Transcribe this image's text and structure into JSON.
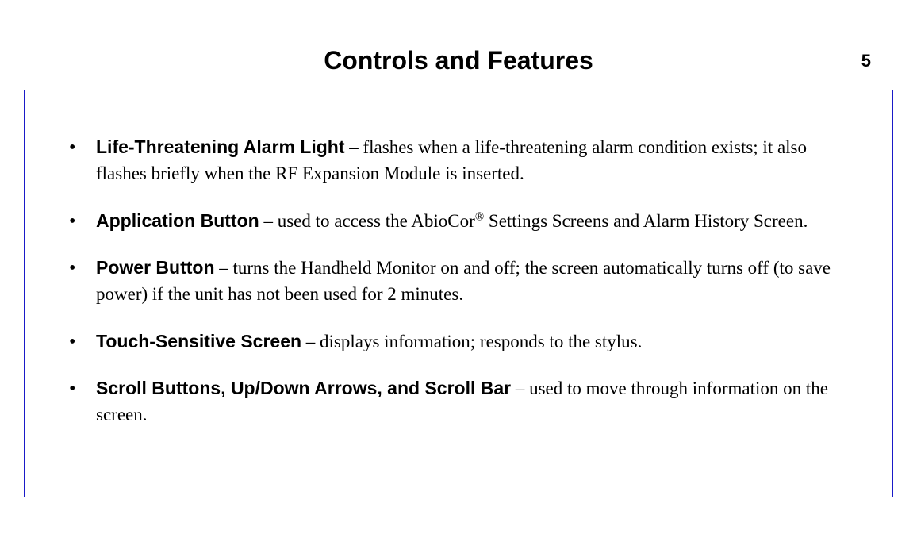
{
  "page_number": "5",
  "title": "Controls and Features",
  "items": [
    {
      "term": "Life-Threatening Alarm Light",
      "desc_before": " – flashes when a life-threatening alarm condition exists; it also flashes briefly when the RF Expansion Module is inserted.",
      "has_sup": false
    },
    {
      "term": "Application Button",
      "desc_before": " – used to access the AbioCor",
      "sup": "®",
      "desc_after": " Settings Screens and Alarm History Screen.",
      "has_sup": true
    },
    {
      "term": "Power Button",
      "desc_before": " – turns the Handheld Monitor on and off; the screen automatically turns off (to save power) if the unit has not been used for 2 minutes.",
      "has_sup": false
    },
    {
      "term": "Touch-Sensitive Screen",
      "desc_before": " – displays information; responds to the stylus.",
      "has_sup": false
    },
    {
      "term": "Scroll Buttons, Up/Down Arrows, and Scroll Bar",
      "desc_before": " – used to move through information on the screen.",
      "has_sup": false
    }
  ]
}
